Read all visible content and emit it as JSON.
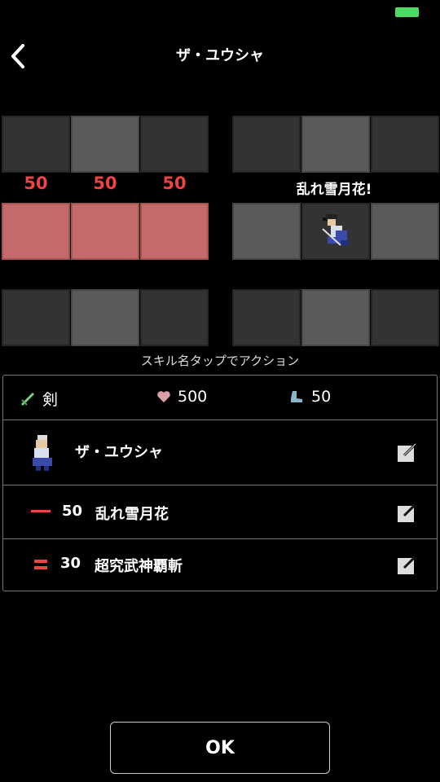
{
  "header": {
    "title": "ザ・ユウシャ"
  },
  "battle": {
    "damage": [
      "50",
      "50",
      "50"
    ],
    "skill_name": "乱れ雪月花!"
  },
  "hint": "スキル名タップでアクション",
  "stats": {
    "weapon": "剣",
    "hp": "500",
    "speed": "50"
  },
  "rows": [
    {
      "name": "ザ・ユウシャ"
    },
    {
      "value": "50",
      "name": "乱れ雪月花",
      "color": "#e44"
    },
    {
      "value": "30",
      "name": "超究武神覇斬",
      "color": "#e44"
    }
  ],
  "ok_label": "OK"
}
